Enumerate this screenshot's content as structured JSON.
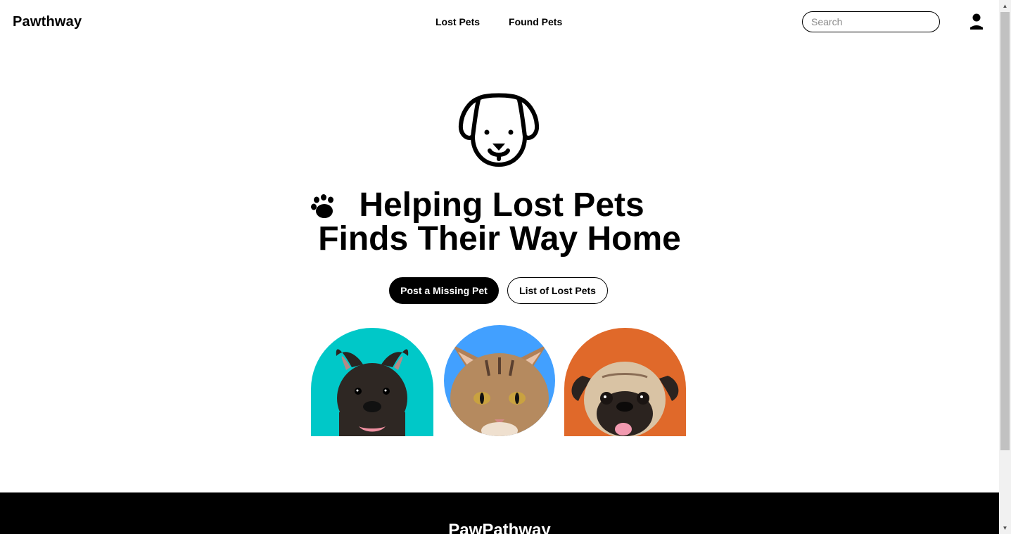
{
  "header": {
    "brand": "Pawthway",
    "nav": [
      {
        "label": "Lost Pets"
      },
      {
        "label": "Found Pets"
      }
    ],
    "search": {
      "placeholder": "Search",
      "value": ""
    },
    "user_icon": "user-icon"
  },
  "hero": {
    "logo_icon": "dog-face-icon",
    "paw_icon": "paw-icon",
    "title_line1": "Helping Lost Pets",
    "title_line2": "Finds Their Way Home",
    "primary_button": "Post a Missing Pet",
    "secondary_button": "List of Lost Pets"
  },
  "pets": [
    {
      "kind": "french-bulldog",
      "bg_color": "#00c8c8"
    },
    {
      "kind": "tabby-cat",
      "bg_color": "#42a0ff"
    },
    {
      "kind": "pug",
      "bg_color": "#e0692a"
    }
  ],
  "footer": {
    "brand": "PawPathway"
  }
}
